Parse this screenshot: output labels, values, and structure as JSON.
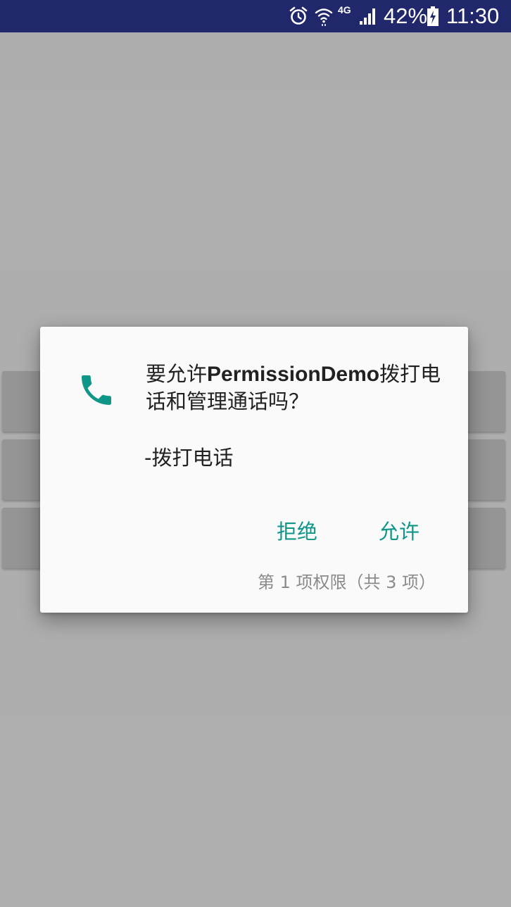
{
  "status_bar": {
    "network_type": "4G",
    "battery_percent": "42%",
    "time": "11:30",
    "icons": [
      "alarm-icon",
      "wifi-icon",
      "cellular-signal-icon",
      "battery-charging-icon"
    ]
  },
  "dialog": {
    "icon": "phone-icon",
    "accent_color": "#0f9688",
    "message_prefix": "要允许",
    "app_name": "PermissionDemo",
    "message_suffix": "拨打电话和管理通话吗？",
    "detail": "-拨打电话",
    "deny_label": "拒绝",
    "allow_label": "允许",
    "page_indicator": "第 1 项权限（共 3 项）"
  }
}
